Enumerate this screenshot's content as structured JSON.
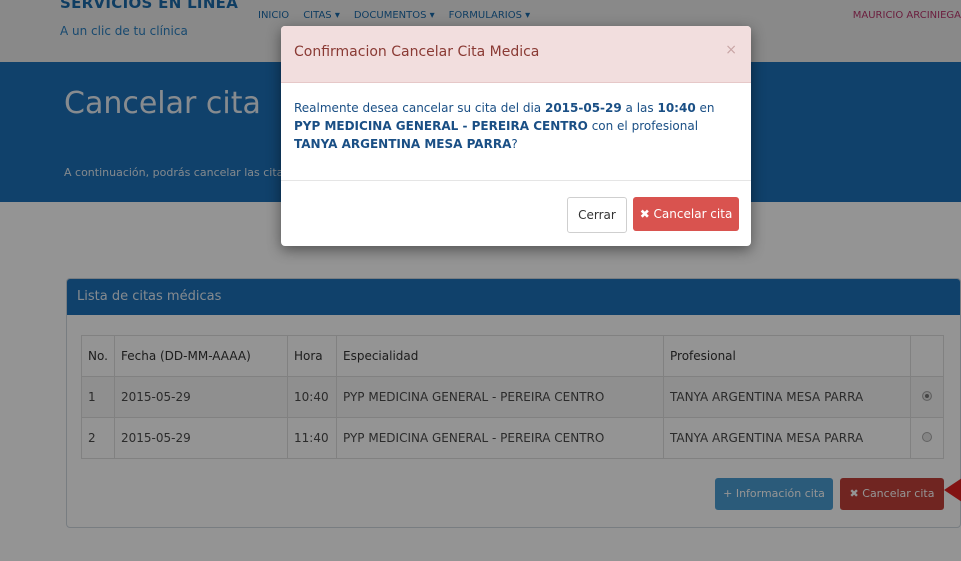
{
  "header": {
    "brand_title": "SERVICIOS EN LINEA",
    "brand_subtitle": "A un clic de tu clínica",
    "nav": [
      "INICIO",
      "CITAS ▾",
      "DOCUMENTOS ▾",
      "FORMULARIOS ▾"
    ],
    "user": "MAURICIO ARCINIEGA"
  },
  "hero": {
    "title": "Cancelar cita",
    "description": "A continuación, podrás cancelar las cita"
  },
  "panel": {
    "title": "Lista de citas médicas",
    "columns": [
      "No.",
      "Fecha (DD-MM-AAAA)",
      "Hora",
      "Especialidad",
      "Profesional",
      ""
    ],
    "rows": [
      {
        "no": "1",
        "fecha": "2015-05-29",
        "hora": "10:40",
        "especialidad": "PYP MEDICINA GENERAL - PEREIRA CENTRO",
        "profesional": "TANYA ARGENTINA MESA PARRA",
        "selected": true
      },
      {
        "no": "2",
        "fecha": "2015-05-29",
        "hora": "11:40",
        "especialidad": "PYP MEDICINA GENERAL - PEREIRA CENTRO",
        "profesional": "TANYA ARGENTINA MESA PARRA",
        "selected": false
      }
    ],
    "info_button": "+ Información cita",
    "cancel_button": "✖ Cancelar cita"
  },
  "modal": {
    "title": "Confirmacion Cancelar Cita Medica",
    "close": "×",
    "text_1": "Realmente desea cancelar su cita del dia ",
    "fecha": "2015-05-29",
    "text_2": " a las ",
    "hora": "10:40",
    "text_3": " en ",
    "especialidad": "PYP MEDICINA GENERAL - PEREIRA CENTRO",
    "text_4": " con el profesional ",
    "profesional": "TANYA ARGENTINA MESA PARRA",
    "text_5": "?",
    "close_button": "Cerrar",
    "cancel_button": "✖ Cancelar cita"
  },
  "colors": {
    "primary": "#1d71b8",
    "danger": "#d9534f",
    "modal_header": "#f2dede"
  }
}
